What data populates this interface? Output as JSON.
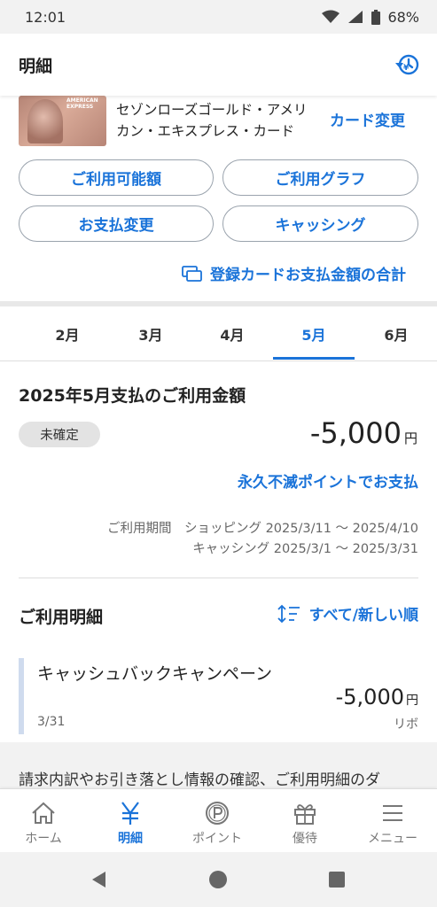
{
  "status_bar": {
    "time": "12:01",
    "battery": "68%"
  },
  "header": {
    "title": "明細",
    "history_icon": "history-icon"
  },
  "card": {
    "brand_text": "AMERICAN EXPRESS",
    "name_line1": "セゾンローズゴールド・アメリ",
    "name_line2": "カン・エキスプレス・カード",
    "change_label": "カード変更"
  },
  "actions": {
    "limit": "ご利用可能額",
    "graph": "ご利用グラフ",
    "pay_change": "お支払変更",
    "cashing": "キャッシング"
  },
  "registered_total_link": "登録カードお支払金額の合計",
  "months": [
    "2月",
    "3月",
    "4月",
    "5月",
    "6月"
  ],
  "selected_month": "5月",
  "summary": {
    "title": "2025年5月支払のご利用金額",
    "status_badge": "未確定",
    "amount": "-5,000",
    "unit": "円",
    "points_link": "永久不滅ポイントでお支払",
    "period_line1": "ご利用期間　ショッピング 2025/3/11 〜 2025/4/10",
    "period_line2": "キャッシング 2025/3/1 〜 2025/3/31"
  },
  "details": {
    "title": "ご利用明細",
    "sort_label": "すべて/新しい順",
    "transactions": [
      {
        "name": "キャッシュバックキャンペーン",
        "date": "3/31",
        "amount": "-5,000",
        "unit": "円",
        "kind": "リボ"
      }
    ]
  },
  "note": "請求内訳やお引き落とし情報の確認、ご利用明細のダ",
  "tabbar": [
    {
      "label": "ホーム",
      "icon": "home-icon"
    },
    {
      "label": "明細",
      "icon": "yen-icon"
    },
    {
      "label": "ポイント",
      "icon": "point-icon"
    },
    {
      "label": "優待",
      "icon": "gift-icon"
    },
    {
      "label": "メニュー",
      "icon": "menu-icon"
    }
  ],
  "colors": {
    "accent": "#1a73d9",
    "badge_bg": "#e3e3e3",
    "tx_bar": "#cfdbee"
  }
}
